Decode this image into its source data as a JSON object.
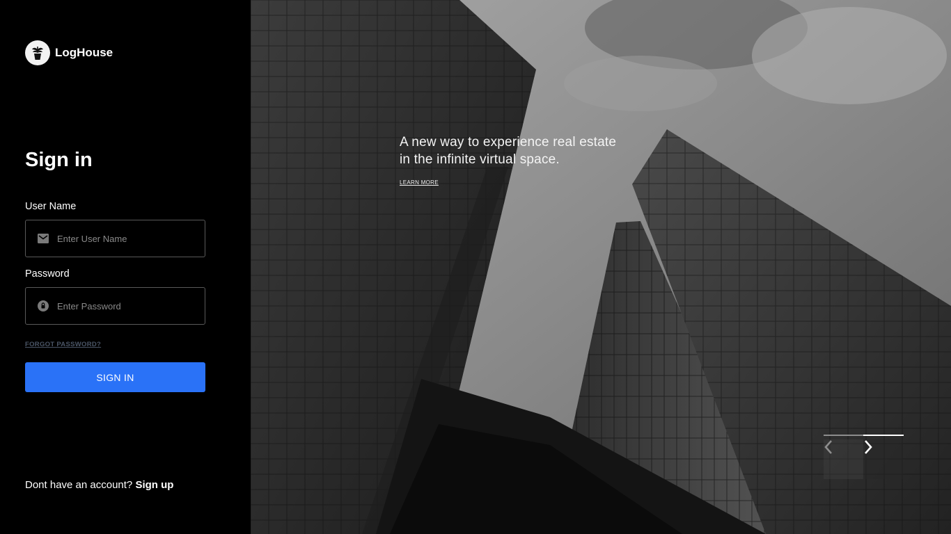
{
  "brand": {
    "name": "LogHouse"
  },
  "signin": {
    "title": "Sign in",
    "username_label": "User Name",
    "username_placeholder": "Enter User Name",
    "password_label": "Password",
    "password_placeholder": "Enter Password",
    "forgot_label": "FORGOT PASSWORD?",
    "submit_label": "SIGN IN"
  },
  "signup": {
    "prompt": "Dont have an account?",
    "link": "Sign up"
  },
  "hero": {
    "tagline_line1": "A new way to experience real estate",
    "tagline_line2": "in the infinite virtual space.",
    "learn_more": "LEARN MORE",
    "slide_progress": 0.5
  },
  "colors": {
    "accent": "#2a72f7",
    "panel_bg": "#000000",
    "input_border": "#5a5a5a"
  },
  "icons": {
    "logo": "plant-pot-icon",
    "username": "mail-icon",
    "password": "lock-circle-icon",
    "prev": "chevron-left-icon",
    "next": "chevron-right-icon"
  }
}
